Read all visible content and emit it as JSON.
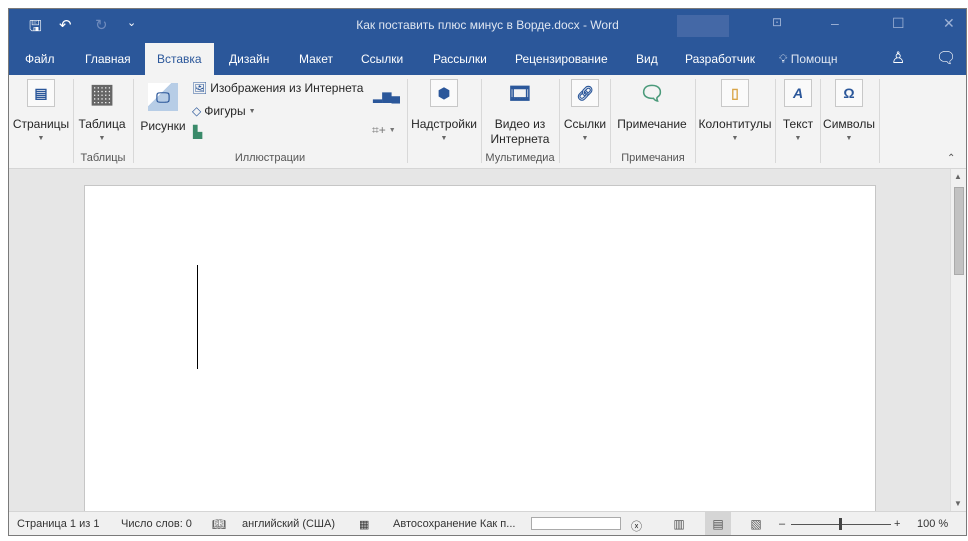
{
  "window": {
    "title": "Как поставить плюс минус в Ворде.docx - Word",
    "accent": "#2b579a"
  },
  "quick_access": {
    "save": "🖫",
    "undo": "↶",
    "redo": "↻",
    "customize": "⌄"
  },
  "tabs": [
    {
      "label": "Файл"
    },
    {
      "label": "Главная"
    },
    {
      "label": "Вставка",
      "active": true
    },
    {
      "label": "Дизайн"
    },
    {
      "label": "Макет"
    },
    {
      "label": "Ссылки"
    },
    {
      "label": "Рассылки"
    },
    {
      "label": "Рецензирование"
    },
    {
      "label": "Вид"
    },
    {
      "label": "Разработчик"
    }
  ],
  "tell_me": "Помощн",
  "ribbon": {
    "pages": "Страницы",
    "table": "Таблица",
    "pictures": "Рисунки",
    "online_pictures": "Изображения из Интернета",
    "shapes": "Фигуры",
    "addins": "Надстройки",
    "online_video": "Видео из Интернета",
    "links": "Ссылки",
    "comment": "Примечание",
    "header_footer": "Колонтитулы",
    "text": "Текст",
    "symbols": "Символы",
    "groups": {
      "tables": "Таблицы",
      "illustrations": "Иллюстрации",
      "media": "Мультимедиа",
      "comments": "Примечания"
    }
  },
  "status": {
    "page": "Страница 1 из 1",
    "words": "Число слов: 0",
    "language": "английский (США)",
    "autosave": "Автосохранение Как п...",
    "zoom": "100 %",
    "zoom_percent": 100
  }
}
